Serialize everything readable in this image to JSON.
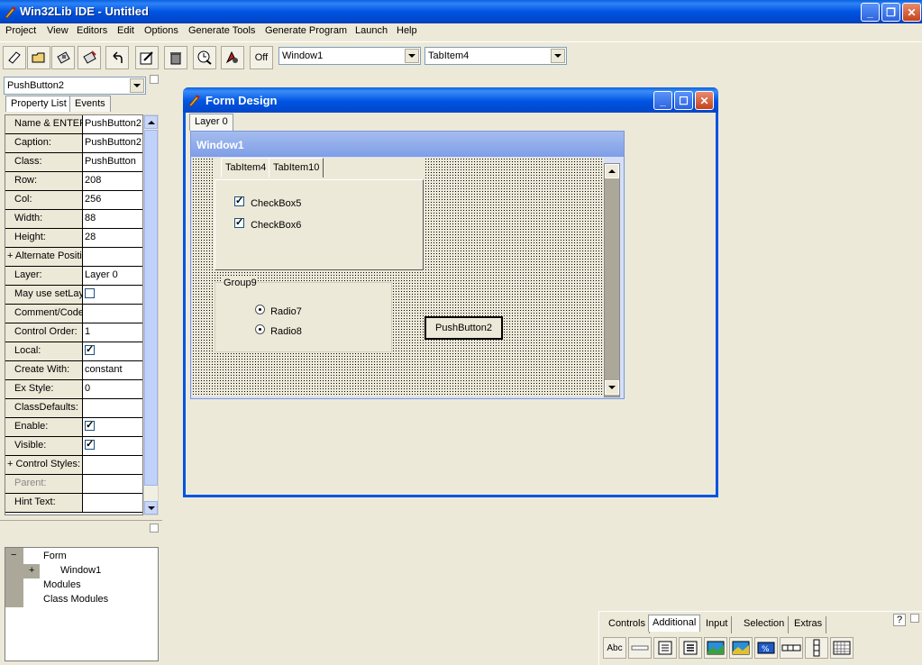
{
  "app": {
    "title": "Win32Lib IDE - Untitled",
    "window_buttons": [
      "_",
      "❐",
      "✕"
    ]
  },
  "menu": [
    "Project",
    "View",
    "Editors",
    "Edit",
    "Options",
    "Generate Tools",
    "Generate Program",
    "Launch",
    "Help"
  ],
  "toolbar": {
    "off_label": "Off",
    "window_combo": "Window1",
    "control_combo": "TabItem4"
  },
  "left_panel": {
    "selector": "PushButton2",
    "tabs": [
      "Property List",
      "Events"
    ],
    "properties": [
      {
        "key": "Name & ENTER",
        "value": "PushButton2"
      },
      {
        "key": "Caption:",
        "value": "PushButton2"
      },
      {
        "key": "Class:",
        "value": "PushButton"
      },
      {
        "key": "Row:",
        "value": "208"
      },
      {
        "key": "Col:",
        "value": "256"
      },
      {
        "key": "Width:",
        "value": "88"
      },
      {
        "key": "Height:",
        "value": "28"
      },
      {
        "key": "+ Alternate Positio",
        "value": ""
      },
      {
        "key": "Layer:",
        "value": "Layer 0"
      },
      {
        "key": "May use setLay",
        "value": ""
      },
      {
        "key": "Comment/Code",
        "value": ""
      },
      {
        "key": "Control Order:",
        "value": "1"
      },
      {
        "key": "Local:",
        "value": ""
      },
      {
        "key": "Create With:",
        "value": "constant"
      },
      {
        "key": "Ex Style:",
        "value": "0"
      },
      {
        "key": "ClassDefaults:",
        "value": ""
      },
      {
        "key": "Enable:",
        "value": ""
      },
      {
        "key": "Visible:",
        "value": ""
      },
      {
        "key": "+ Control Styles:",
        "value": ""
      },
      {
        "key": "Parent:",
        "value": ""
      },
      {
        "key": "Hint Text:",
        "value": ""
      }
    ],
    "tree": {
      "collapse": "−",
      "expand": "+",
      "form": "Form",
      "window": "Window1",
      "modules": "Modules",
      "class_modules": "Class Modules"
    }
  },
  "form_design": {
    "title": "Form Design",
    "layer_tab": "Layer 0",
    "window_title": "Window1",
    "tab_items": [
      "TabItem4",
      "TabItem10"
    ],
    "checkboxes": [
      "CheckBox5",
      "CheckBox6"
    ],
    "group_label": "Group9",
    "radios": [
      "Radio7",
      "Radio8"
    ],
    "push_button": "PushButton2"
  },
  "palette": {
    "tabs": [
      "Controls",
      "Additional",
      "Input",
      "Selection",
      "Extras"
    ],
    "help": "?",
    "first_icon_label": "Abc"
  }
}
